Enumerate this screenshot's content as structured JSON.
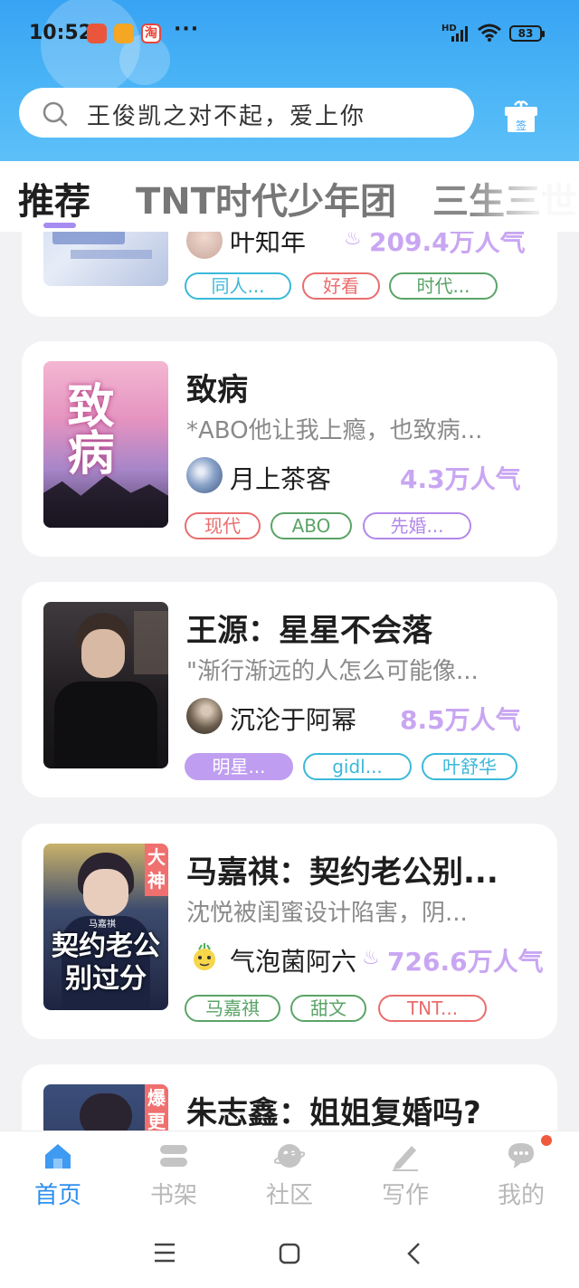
{
  "status_bar": {
    "time": "10:52",
    "dots": "···",
    "network": "HD",
    "battery": "83"
  },
  "search": {
    "query": "王俊凯之对不起，爱上你"
  },
  "gift_label": "签",
  "tabs": [
    {
      "label": "推荐",
      "active": true
    },
    {
      "label": "TNT时代少年团",
      "active": false
    },
    {
      "label": "三生三世",
      "active": false
    }
  ],
  "books": [
    {
      "title": "",
      "desc": "",
      "author": "叶知年",
      "popularity": "209.4万人气",
      "tags": [
        {
          "label": "同人...",
          "color": "blue"
        },
        {
          "label": "好看",
          "color": "red"
        },
        {
          "label": "时代...",
          "color": "green"
        }
      ]
    },
    {
      "title": "致病",
      "desc": "*ABO他让我上瘾，也致病...",
      "author": "月上茶客",
      "popularity": "4.3万人气",
      "cover_text": "致病",
      "tags": [
        {
          "label": "现代",
          "color": "red"
        },
        {
          "label": "ABO",
          "color": "green"
        },
        {
          "label": "先婚...",
          "color": "purple"
        }
      ]
    },
    {
      "title": "王源：星星不会落",
      "desc": "\"渐行渐远的人怎么可能像...",
      "author": "沉沦于阿幂",
      "popularity": "8.5万人气",
      "tags": [
        {
          "label": "明星...",
          "color": "purple-fill"
        },
        {
          "label": "gidl...",
          "color": "blue"
        },
        {
          "label": "叶舒华",
          "color": "blue"
        }
      ]
    },
    {
      "title": "马嘉祺：契约老公别...",
      "desc": "沈悦被闺蜜设计陷害，阴...",
      "author": "气泡菌阿六",
      "popularity": "726.6万人气",
      "badge": "大神",
      "cover_text_small": "马嘉祺",
      "cover_text": "契约老公别过分",
      "tags": [
        {
          "label": "马嘉祺",
          "color": "green"
        },
        {
          "label": "甜文",
          "color": "green"
        },
        {
          "label": "TNT...",
          "color": "red"
        }
      ]
    },
    {
      "title": "朱志鑫：姐姐复婚吗?",
      "badge": "爆更"
    }
  ],
  "nav": [
    {
      "label": "首页",
      "icon": "home-icon",
      "active": true
    },
    {
      "label": "书架",
      "icon": "bookshelf-icon",
      "active": false
    },
    {
      "label": "社区",
      "icon": "planet-icon",
      "active": false
    },
    {
      "label": "写作",
      "icon": "pen-icon",
      "active": false
    },
    {
      "label": "我的",
      "icon": "chat-bubble-icon",
      "active": false
    }
  ],
  "colors": {
    "header_blue": "#37a3f3",
    "accent_purple": "#a68cf0",
    "popularity": "#c9a6f2",
    "nav_active": "#2f8fee",
    "badge_red": "#f06f6f"
  }
}
